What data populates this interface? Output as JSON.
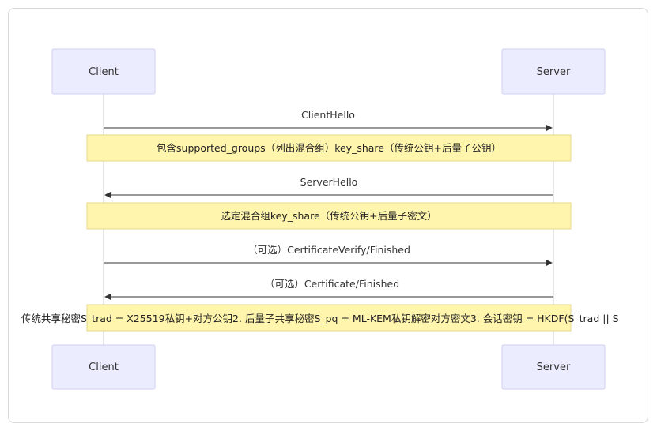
{
  "diagram": {
    "type": "sequence",
    "participants": {
      "client": "Client",
      "server": "Server"
    },
    "messages": [
      {
        "label": "ClientHello",
        "from": "client",
        "to": "server"
      },
      {
        "label": "ServerHello",
        "from": "server",
        "to": "client"
      },
      {
        "label": "（可选）CertificateVerify/Finished",
        "from": "client",
        "to": "server"
      },
      {
        "label": "（可选）Certificate/Finished",
        "from": "server",
        "to": "client"
      }
    ],
    "notes": [
      "包含supported_groups（列出混合组）key_share（传统公钥+后量子公钥）",
      "选定混合组key_share（传统公钥+后量子密文）",
      "传统共享秘密S_trad = X25519私钥+对方公钥2. 后量子共享秘密S_pq = ML-KEM私钥解密对方密文3. 会话密钥 = HKDF(S_trad || S"
    ],
    "colors": {
      "actor_fill": "#ececff",
      "note_fill": "#fff5ad",
      "line": "#333333"
    }
  }
}
